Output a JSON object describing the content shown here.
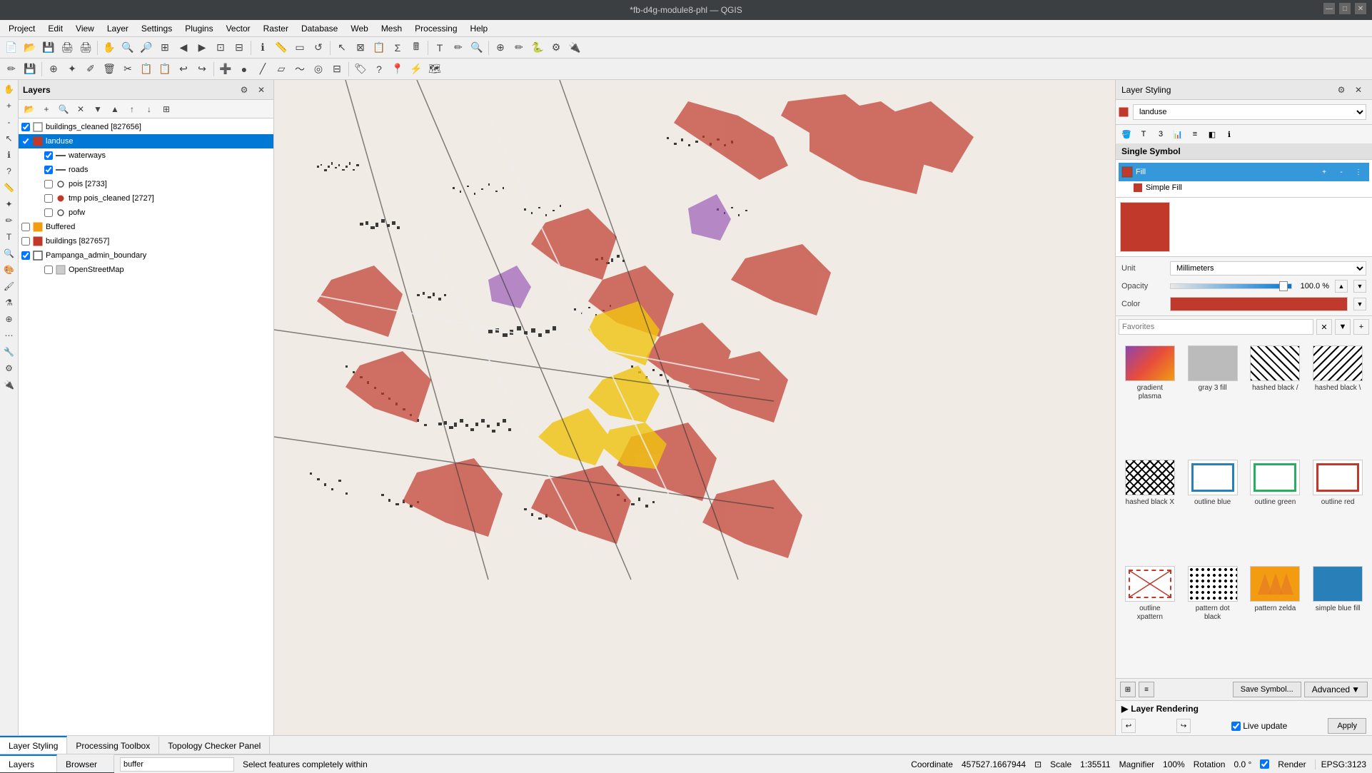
{
  "titlebar": {
    "title": "*fb-d4g-module8-phl — QGIS",
    "min": "—",
    "max": "□",
    "close": "✕"
  },
  "menubar": {
    "items": [
      "Project",
      "Edit",
      "View",
      "Layer",
      "Settings",
      "Plugins",
      "Vector",
      "Raster",
      "Database",
      "Web",
      "Mesh",
      "Processing",
      "Help"
    ]
  },
  "layers_panel": {
    "title": "Layers",
    "layers": [
      {
        "id": "buildings_cleaned",
        "name": "buildings_cleaned [827656]",
        "checked": true,
        "indent": 0,
        "type": "polygon",
        "color": "#888"
      },
      {
        "id": "landuse",
        "name": "landuse",
        "checked": true,
        "indent": 0,
        "type": "polygon",
        "color": "#c0392b",
        "selected": true
      },
      {
        "id": "waterways",
        "name": "waterways",
        "checked": true,
        "indent": 1,
        "type": "line",
        "color": "#555"
      },
      {
        "id": "roads",
        "name": "roads",
        "checked": true,
        "indent": 1,
        "type": "line",
        "color": "#555"
      },
      {
        "id": "pois",
        "name": "pois [2733]",
        "checked": false,
        "indent": 1,
        "type": "point",
        "color": "#555"
      },
      {
        "id": "tmp_pois",
        "name": "tmp pois_cleaned [2727]",
        "checked": false,
        "indent": 1,
        "type": "point",
        "color": "#c0392b"
      },
      {
        "id": "pofw",
        "name": "pofw",
        "checked": false,
        "indent": 1,
        "type": "point",
        "color": "#555"
      },
      {
        "id": "Buffered",
        "name": "Buffered",
        "checked": false,
        "indent": 0,
        "type": "polygon",
        "color": "#f39c12"
      },
      {
        "id": "buildings",
        "name": "buildings [827657]",
        "checked": false,
        "indent": 0,
        "type": "polygon",
        "color": "#c0392b"
      },
      {
        "id": "Pampanga",
        "name": "Pampanga_admin_boundary",
        "checked": true,
        "indent": 0,
        "type": "polygon",
        "color": "#555"
      },
      {
        "id": "OSM",
        "name": "OpenStreetMap",
        "checked": false,
        "indent": 1,
        "type": "raster",
        "color": "#777"
      }
    ]
  },
  "layer_styling": {
    "panel_title": "Layer Styling",
    "layer_name": "landuse",
    "symbol_type": "Single Symbol",
    "fill_label": "Fill",
    "simple_fill_label": "Simple Fill",
    "unit_label": "Unit",
    "unit_value": "Millimeters",
    "opacity_label": "Opacity",
    "opacity_value": "100.0 %",
    "color_label": "Color",
    "favorites_placeholder": "Favorites",
    "grid_items": [
      {
        "id": "gradient_plasma",
        "label": "gradient\nplasma",
        "type": "gradient"
      },
      {
        "id": "gray_3_fill",
        "label": "gray 3 fill",
        "type": "gray"
      },
      {
        "id": "hashed_black_slash",
        "label": "hashed black /",
        "type": "hashed_diag1"
      },
      {
        "id": "hashed_black_backslash",
        "label": "hashed black \\",
        "type": "hashed_diag2"
      },
      {
        "id": "hashed_black_x",
        "label": "hashed black\nX",
        "type": "hashed_x"
      },
      {
        "id": "outline_blue",
        "label": "outline blue",
        "type": "outline_blue"
      },
      {
        "id": "outline_green",
        "label": "outline green",
        "type": "outline_green"
      },
      {
        "id": "outline_red",
        "label": "outline red",
        "type": "outline_red"
      },
      {
        "id": "outline_xpattern",
        "label": "outline\nxpattern",
        "type": "outline_xpattern"
      },
      {
        "id": "pattern_dot_black",
        "label": "pattern dot\nblack",
        "type": "dot_black"
      },
      {
        "id": "pattern_zelda",
        "label": "pattern zelda",
        "type": "zelda"
      },
      {
        "id": "simple_blue_fill",
        "label": "simple blue fill",
        "type": "simple_blue"
      }
    ],
    "save_symbol_label": "Save Symbol...",
    "advanced_label": "Advanced",
    "layer_rendering_label": "Layer Rendering",
    "live_update_label": "Live update",
    "apply_label": "Apply"
  },
  "bottom_tabs": [
    {
      "id": "layer_styling",
      "label": "Layer Styling",
      "active": true
    },
    {
      "id": "processing_toolbox",
      "label": "Processing Toolbox",
      "active": false
    },
    {
      "id": "topology_checker",
      "label": "Topology Checker Panel",
      "active": false
    }
  ],
  "layers_browser_tabs": [
    {
      "id": "layers",
      "label": "Layers",
      "active": true
    },
    {
      "id": "browser",
      "label": "Browser",
      "active": false
    }
  ],
  "statusbar": {
    "search_placeholder": "buffer",
    "status_text": "Select features completely within",
    "coordinate_label": "Coordinate",
    "coordinate_value": "457527.1667944",
    "scale_label": "Scale",
    "scale_value": "1:35511",
    "magnifier_label": "Magnifier",
    "magnifier_value": "100%",
    "rotation_label": "Rotation",
    "rotation_value": "0.0 °",
    "render_label": "Render",
    "epsg_label": "EPSG:3123"
  }
}
